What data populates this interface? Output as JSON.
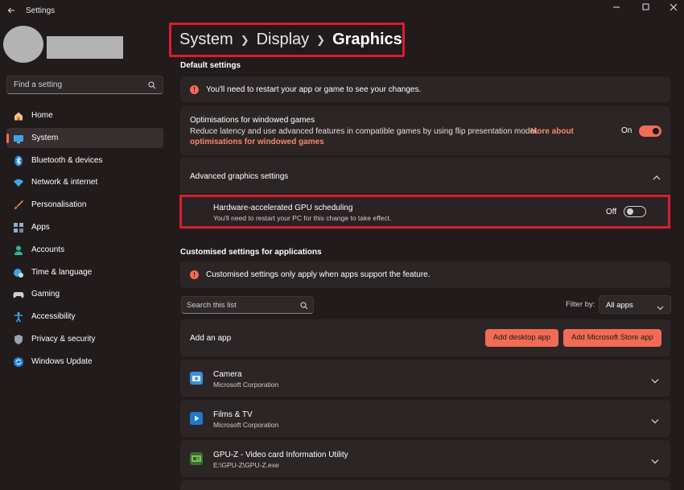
{
  "window": {
    "title": "Settings"
  },
  "sidebar": {
    "search_placeholder": "Find a setting",
    "items": [
      {
        "label": "Home",
        "icon": "home-icon"
      },
      {
        "label": "System",
        "icon": "system-icon",
        "active": true
      },
      {
        "label": "Bluetooth & devices",
        "icon": "bluetooth-icon"
      },
      {
        "label": "Network & internet",
        "icon": "wifi-icon"
      },
      {
        "label": "Personalisation",
        "icon": "brush-icon"
      },
      {
        "label": "Apps",
        "icon": "apps-icon"
      },
      {
        "label": "Accounts",
        "icon": "person-icon"
      },
      {
        "label": "Time & language",
        "icon": "globe-icon"
      },
      {
        "label": "Gaming",
        "icon": "gamepad-icon"
      },
      {
        "label": "Accessibility",
        "icon": "accessibility-icon"
      },
      {
        "label": "Privacy & security",
        "icon": "shield-icon"
      },
      {
        "label": "Windows Update",
        "icon": "update-icon"
      }
    ]
  },
  "breadcrumb": {
    "items": [
      "System",
      "Display"
    ],
    "current": "Graphics"
  },
  "default_settings": {
    "heading": "Default settings",
    "restart_notice": "You'll need to restart your app or game to see your changes.",
    "windowed": {
      "title": "Optimisations for windowed games",
      "description": "Reduce latency and use advanced features in compatible games by using flip presentation model.",
      "link_part1": "More about",
      "link_part2": "optimisations for windowed games",
      "state_label": "On",
      "enabled": true
    },
    "advanced": {
      "title": "Advanced graphics settings"
    },
    "gpu_scheduling": {
      "title": "Hardware-accelerated GPU scheduling",
      "description": "You'll need to restart your PC for this change to take effect.",
      "state_label": "Off",
      "enabled": false
    }
  },
  "custom_settings": {
    "heading": "Customised settings for applications",
    "notice": "Customised settings only apply when apps support the feature.",
    "search_placeholder": "Search this list",
    "filter_label": "Filter by:",
    "filter_value": "All apps",
    "add_app_label": "Add an app",
    "add_desktop_button": "Add desktop app",
    "add_store_button": "Add Microsoft Store app",
    "apps": [
      {
        "name": "Camera",
        "publisher": "Microsoft Corporation",
        "icon": "camera-icon"
      },
      {
        "name": "Films & TV",
        "publisher": "Microsoft Corporation",
        "icon": "films-tv-icon"
      },
      {
        "name": "GPU-Z - Video card Information Utility",
        "publisher": "E:\\GPU-Z\\GPU-Z.exe",
        "icon": "gpu-z-icon"
      }
    ]
  },
  "colors": {
    "accent": "#f26b55",
    "background": "#221b1c",
    "card": "#2c2526",
    "highlight": "#d81e2c"
  }
}
